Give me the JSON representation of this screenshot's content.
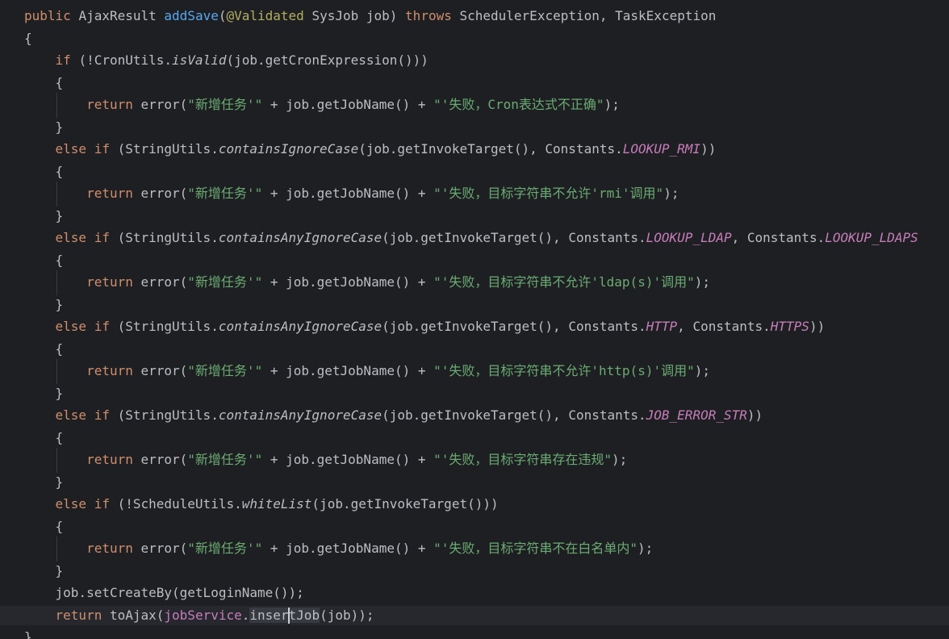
{
  "editor": {
    "language": "java",
    "theme": "dark",
    "colors": {
      "background": "#1e1f22",
      "default_text": "#bcbec4",
      "keyword": "#cf8e6d",
      "method_declaration": "#56a8f5",
      "annotation": "#b3ae60",
      "string": "#6aab73",
      "static_constant": "#c77dbb",
      "caret_line": "#26282e"
    },
    "lines": [
      [
        [
          "public ",
          "kw"
        ],
        [
          "AjaxResult ",
          ""
        ],
        [
          "addSave",
          "fn"
        ],
        [
          "(",
          ""
        ],
        [
          "@Validated ",
          "ann"
        ],
        [
          "SysJob job) ",
          ""
        ],
        [
          "throws ",
          "kw"
        ],
        [
          "SchedulerException, TaskException",
          ""
        ]
      ],
      [
        [
          "{",
          ""
        ]
      ],
      [
        [
          "    ",
          ""
        ],
        [
          "if ",
          "kw"
        ],
        [
          "(!CronUtils.",
          ""
        ],
        [
          "isValid",
          "ital"
        ],
        [
          "(job.getCronExpression()))",
          ""
        ]
      ],
      [
        [
          "    {",
          ""
        ]
      ],
      [
        [
          "        ",
          ""
        ],
        [
          "return ",
          "kw"
        ],
        [
          "error(",
          ""
        ],
        [
          "\"新增任务'\"",
          "str"
        ],
        [
          " + job.getJobName() + ",
          ""
        ],
        [
          "\"'失败，Cron表达式不正确\"",
          "str"
        ],
        [
          ");",
          ""
        ]
      ],
      [
        [
          "    }",
          ""
        ]
      ],
      [
        [
          "    ",
          ""
        ],
        [
          "else if ",
          "kw"
        ],
        [
          "(StringUtils.",
          ""
        ],
        [
          "containsIgnoreCase",
          "ital"
        ],
        [
          "(job.getInvokeTarget(), Constants.",
          ""
        ],
        [
          "LOOKUP_RMI",
          "const"
        ],
        [
          "))",
          ""
        ]
      ],
      [
        [
          "    {",
          ""
        ]
      ],
      [
        [
          "        ",
          ""
        ],
        [
          "return ",
          "kw"
        ],
        [
          "error(",
          ""
        ],
        [
          "\"新增任务'\"",
          "str"
        ],
        [
          " + job.getJobName() + ",
          ""
        ],
        [
          "\"'失败，目标字符串不允许'rmi'调用\"",
          "str"
        ],
        [
          ");",
          ""
        ]
      ],
      [
        [
          "    }",
          ""
        ]
      ],
      [
        [
          "    ",
          ""
        ],
        [
          "else if ",
          "kw"
        ],
        [
          "(StringUtils.",
          ""
        ],
        [
          "containsAnyIgnoreCase",
          "ital"
        ],
        [
          "(job.getInvokeTarget(), Constants.",
          ""
        ],
        [
          "LOOKUP_LDAP",
          "const"
        ],
        [
          ", Constants.",
          ""
        ],
        [
          "LOOKUP_LDAPS",
          "const"
        ]
      ],
      [
        [
          "    {",
          ""
        ]
      ],
      [
        [
          "        ",
          ""
        ],
        [
          "return ",
          "kw"
        ],
        [
          "error(",
          ""
        ],
        [
          "\"新增任务'\"",
          "str"
        ],
        [
          " + job.getJobName() + ",
          ""
        ],
        [
          "\"'失败，目标字符串不允许'ldap(s)'调用\"",
          "str"
        ],
        [
          ");",
          ""
        ]
      ],
      [
        [
          "    }",
          ""
        ]
      ],
      [
        [
          "    ",
          ""
        ],
        [
          "else if ",
          "kw"
        ],
        [
          "(StringUtils.",
          ""
        ],
        [
          "containsAnyIgnoreCase",
          "ital"
        ],
        [
          "(job.getInvokeTarget(), Constants.",
          ""
        ],
        [
          "HTTP",
          "const"
        ],
        [
          ", Constants.",
          ""
        ],
        [
          "HTTPS",
          "const"
        ],
        [
          "))",
          ""
        ]
      ],
      [
        [
          "    {",
          ""
        ]
      ],
      [
        [
          "        ",
          ""
        ],
        [
          "return ",
          "kw"
        ],
        [
          "error(",
          ""
        ],
        [
          "\"新增任务'\"",
          "str"
        ],
        [
          " + job.getJobName() + ",
          ""
        ],
        [
          "\"'失败，目标字符串不允许'http(s)'调用\"",
          "str"
        ],
        [
          ");",
          ""
        ]
      ],
      [
        [
          "    }",
          ""
        ]
      ],
      [
        [
          "    ",
          ""
        ],
        [
          "else if ",
          "kw"
        ],
        [
          "(StringUtils.",
          ""
        ],
        [
          "containsAnyIgnoreCase",
          "ital"
        ],
        [
          "(job.getInvokeTarget(), Constants.",
          ""
        ],
        [
          "JOB_ERROR_STR",
          "const"
        ],
        [
          "))",
          ""
        ]
      ],
      [
        [
          "    {",
          ""
        ]
      ],
      [
        [
          "        ",
          ""
        ],
        [
          "return ",
          "kw"
        ],
        [
          "error(",
          ""
        ],
        [
          "\"新增任务'\"",
          "str"
        ],
        [
          " + job.getJobName() + ",
          ""
        ],
        [
          "\"'失败，目标字符串存在违规\"",
          "str"
        ],
        [
          ");",
          ""
        ]
      ],
      [
        [
          "    }",
          ""
        ]
      ],
      [
        [
          "    ",
          ""
        ],
        [
          "else if ",
          "kw"
        ],
        [
          "(!ScheduleUtils.",
          ""
        ],
        [
          "whiteList",
          "ital"
        ],
        [
          "(job.getInvokeTarget()))",
          ""
        ]
      ],
      [
        [
          "    {",
          ""
        ]
      ],
      [
        [
          "        ",
          ""
        ],
        [
          "return ",
          "kw"
        ],
        [
          "error(",
          ""
        ],
        [
          "\"新增任务'\"",
          "str"
        ],
        [
          " + job.getJobName() + ",
          ""
        ],
        [
          "\"'失败，目标字符串不在白名单内\"",
          "str"
        ],
        [
          ");",
          ""
        ]
      ],
      [
        [
          "    }",
          ""
        ]
      ],
      [
        [
          "    job.setCreateBy(getLoginName());",
          ""
        ]
      ],
      [
        [
          "    ",
          ""
        ],
        [
          "return ",
          "kw"
        ],
        [
          "toAjax(",
          ""
        ],
        [
          "jobService",
          "field"
        ],
        [
          ".",
          ""
        ],
        [
          "insertJob",
          "hl"
        ],
        [
          "(job));",
          ""
        ]
      ],
      [
        [
          "}",
          ""
        ]
      ]
    ]
  }
}
